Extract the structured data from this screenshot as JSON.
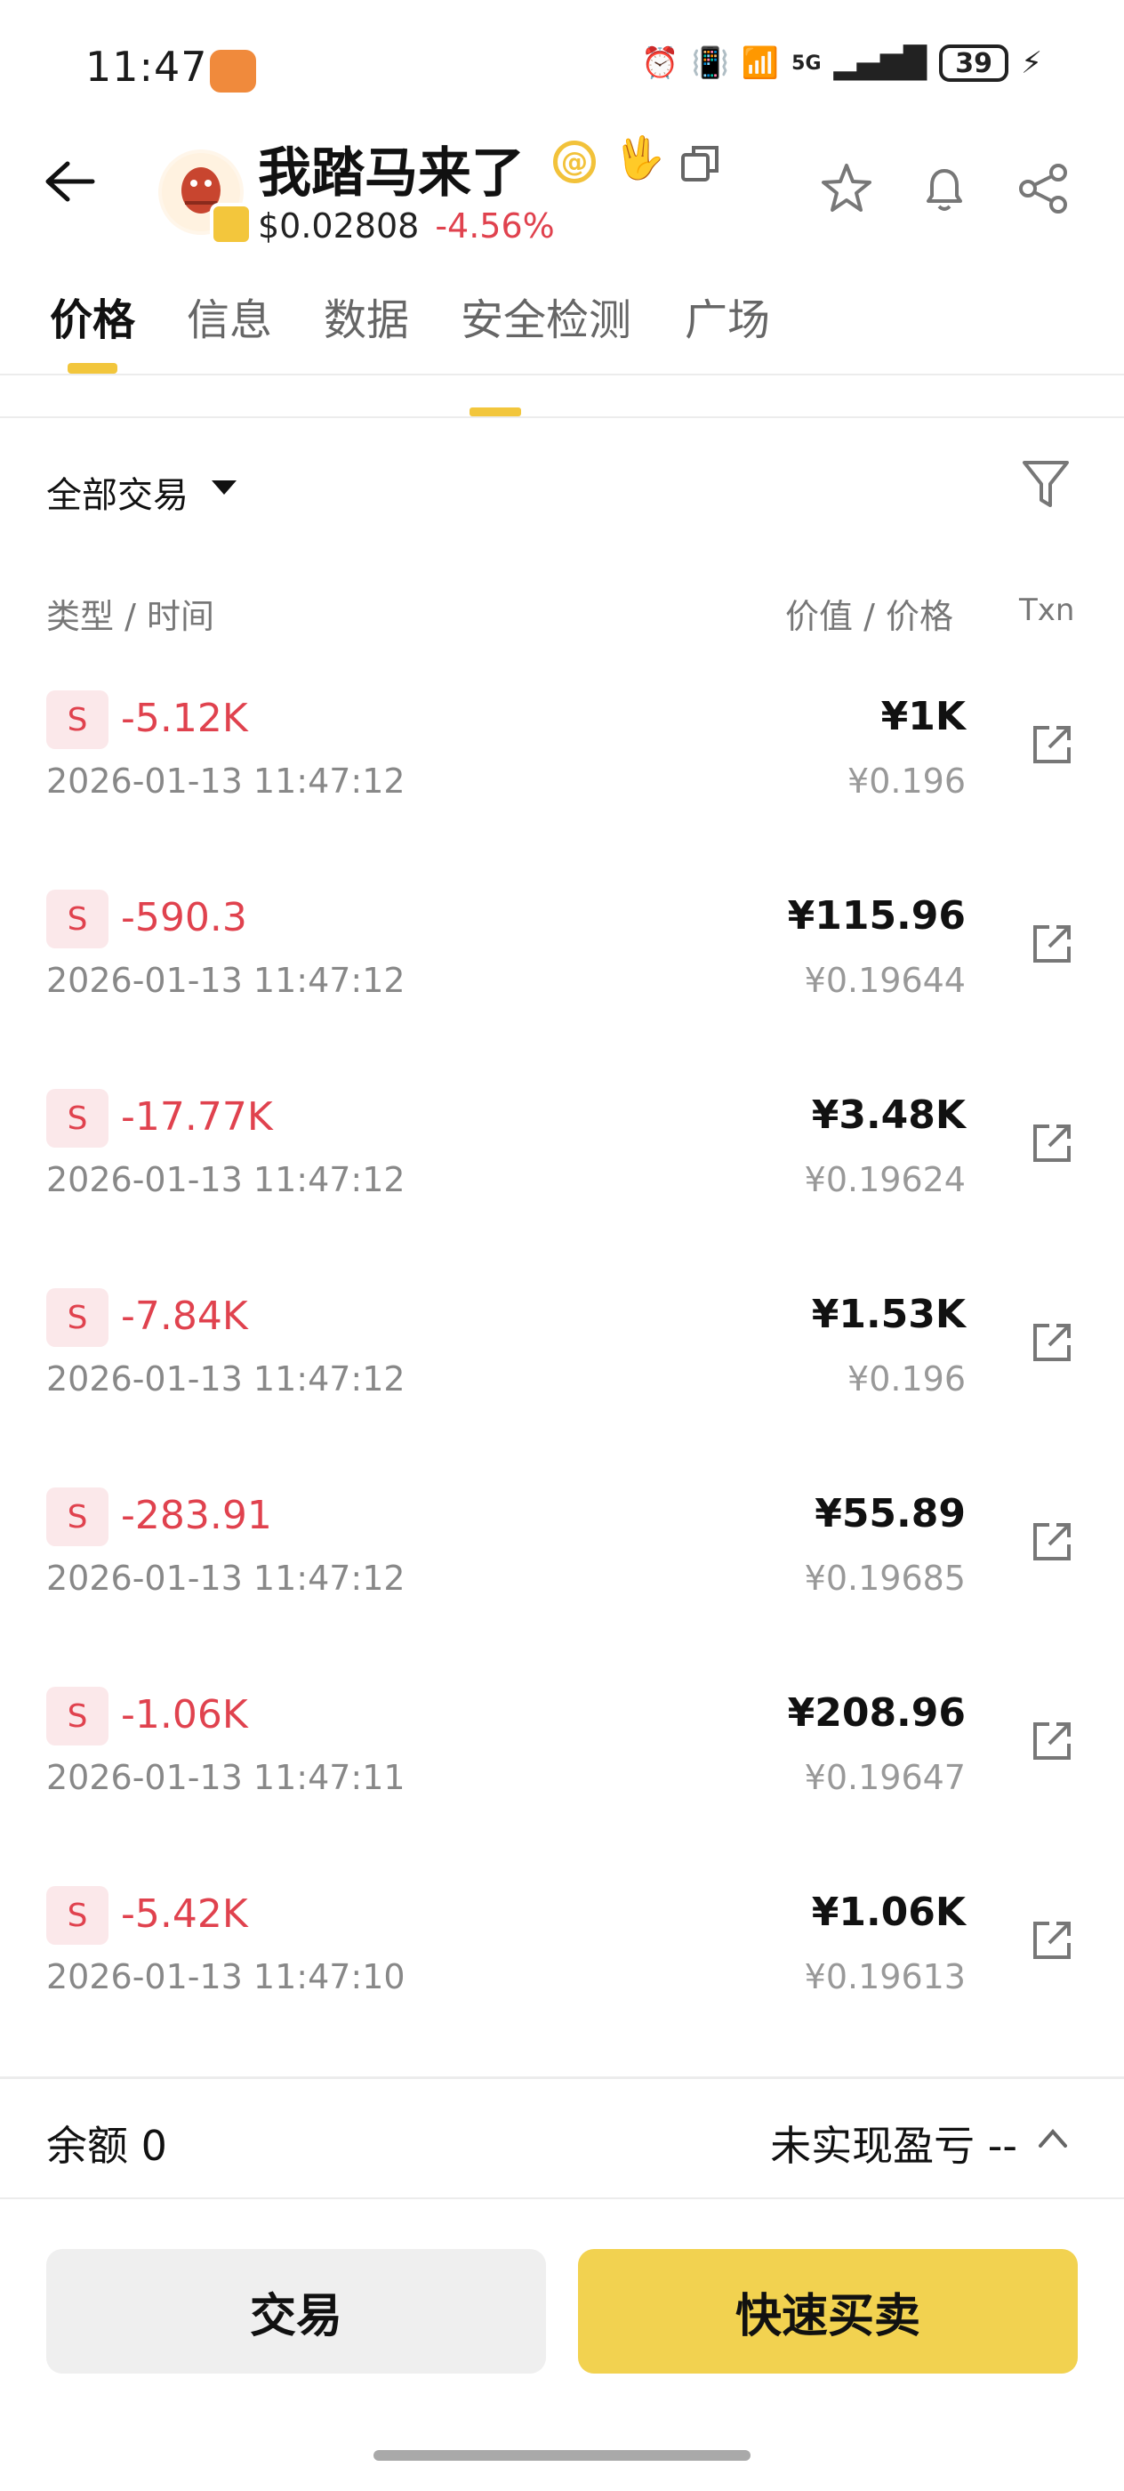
{
  "status_bar": {
    "time": "11:47",
    "network": "5G",
    "battery": "39"
  },
  "header": {
    "token_name": "我踏马来了",
    "price": "$0.02808",
    "change": "-4.56%",
    "change_color": "#e0424e"
  },
  "tabs": [
    "价格",
    "信息",
    "数据",
    "安全检测",
    "广场"
  ],
  "filter": {
    "label": "全部交易"
  },
  "columns": {
    "type_time": "类型 / 时间",
    "value_price": "价值 / 价格",
    "txn": "Txn"
  },
  "transactions": [
    {
      "side": "S",
      "amount": "-5.12K",
      "time": "2026-01-13 11:47:12",
      "value": "¥1K",
      "price": "¥0.196"
    },
    {
      "side": "S",
      "amount": "-590.3",
      "time": "2026-01-13 11:47:12",
      "value": "¥115.96",
      "price": "¥0.19644"
    },
    {
      "side": "S",
      "amount": "-17.77K",
      "time": "2026-01-13 11:47:12",
      "value": "¥3.48K",
      "price": "¥0.19624"
    },
    {
      "side": "S",
      "amount": "-7.84K",
      "time": "2026-01-13 11:47:12",
      "value": "¥1.53K",
      "price": "¥0.196"
    },
    {
      "side": "S",
      "amount": "-283.91",
      "time": "2026-01-13 11:47:12",
      "value": "¥55.89",
      "price": "¥0.19685"
    },
    {
      "side": "S",
      "amount": "-1.06K",
      "time": "2026-01-13 11:47:11",
      "value": "¥208.96",
      "price": "¥0.19647"
    },
    {
      "side": "S",
      "amount": "-5.42K",
      "time": "2026-01-13 11:47:10",
      "value": "¥1.06K",
      "price": "¥0.19613"
    }
  ],
  "footer": {
    "balance": "余额 0",
    "pnl": "未实现盈亏 --",
    "trade_button": "交易",
    "quick_button": "快速买卖"
  },
  "colors": {
    "accent": "#f2d250",
    "sell": "#e0424e"
  }
}
